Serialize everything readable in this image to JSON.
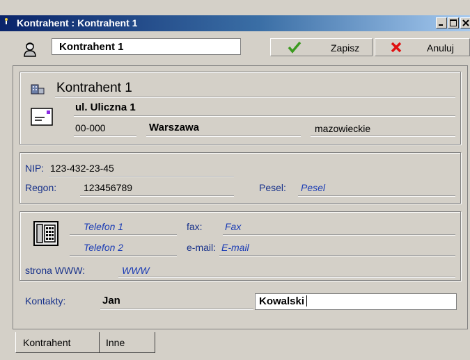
{
  "window": {
    "title": "Kontrahent : Kontrahent 1",
    "title_bar_colors": {
      "start": "#0a246a",
      "end": "#a6caf0"
    }
  },
  "toolbar": {
    "name_field_value": "Kontrahent 1",
    "save_label": "Zapisz",
    "cancel_label": "Anuluj",
    "save_icon": "green-checkmark-icon",
    "cancel_icon": "red-x-icon"
  },
  "address": {
    "name": "Kontrahent 1",
    "street": "ul. Uliczna 1",
    "postal_code": "00-000",
    "city": "Warszawa",
    "region": "mazowieckie"
  },
  "identifiers": {
    "nip_label": "NIP:",
    "nip_value": "123-432-23-45",
    "regon_label": "Regon:",
    "regon_value": "123456789",
    "pesel_label": "Pesel:",
    "pesel_placeholder": "Pesel"
  },
  "contact": {
    "phone1_placeholder": "Telefon 1",
    "phone2_placeholder": "Telefon 2",
    "fax_label": "fax:",
    "fax_placeholder": "Fax",
    "email_label": "e-mail:",
    "email_placeholder": "E-mail",
    "www_label": "strona WWW:",
    "www_placeholder": "WWW"
  },
  "contacts": {
    "label": "Kontakty:",
    "first_name": "Jan",
    "last_name": "Kowalski"
  },
  "tabs": [
    {
      "label": "Kontrahent",
      "active": true
    },
    {
      "label": "Inne",
      "active": false
    }
  ]
}
